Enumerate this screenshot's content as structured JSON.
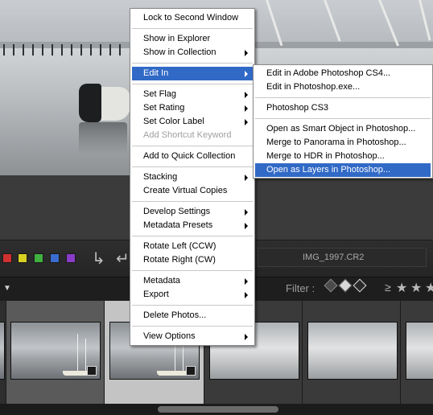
{
  "context_menu": {
    "items": [
      {
        "label": "Lock to Second Window"
      },
      {
        "label": "Show in Explorer"
      },
      {
        "label": "Show in Collection"
      },
      {
        "label": "Edit In"
      },
      {
        "label": "Set Flag"
      },
      {
        "label": "Set Rating"
      },
      {
        "label": "Set Color Label"
      },
      {
        "label": "Add Shortcut Keyword"
      },
      {
        "label": "Add to Quick Collection"
      },
      {
        "label": "Stacking"
      },
      {
        "label": "Create Virtual Copies"
      },
      {
        "label": "Develop Settings"
      },
      {
        "label": "Metadata Presets"
      },
      {
        "label": "Rotate Left (CCW)"
      },
      {
        "label": "Rotate Right (CW)"
      },
      {
        "label": "Metadata"
      },
      {
        "label": "Export"
      },
      {
        "label": "Delete Photos..."
      },
      {
        "label": "View Options"
      }
    ]
  },
  "edit_in_submenu": {
    "items": [
      {
        "label": "Edit in Adobe Photoshop CS4..."
      },
      {
        "label": "Edit in Photoshop.exe..."
      },
      {
        "label": "Photoshop CS3"
      },
      {
        "label": "Open as Smart Object in Photoshop..."
      },
      {
        "label": "Merge to Panorama in Photoshop..."
      },
      {
        "label": "Merge to HDR in Photoshop..."
      },
      {
        "label": "Open as Layers in Photoshop..."
      }
    ]
  },
  "toolbar": {
    "filename": "IMG_1997.CR2",
    "color_labels": [
      "#d03030",
      "#d8d020",
      "#40b040",
      "#3a6cd0",
      "#8a3cc8"
    ]
  },
  "filter_bar": {
    "label": "Filter :",
    "rating_operator": "≥",
    "stars": [
      "★",
      "★",
      "★"
    ]
  },
  "colors": {
    "menu_highlight": "#3169c6",
    "menu_disabled": "#a0a0a0"
  }
}
